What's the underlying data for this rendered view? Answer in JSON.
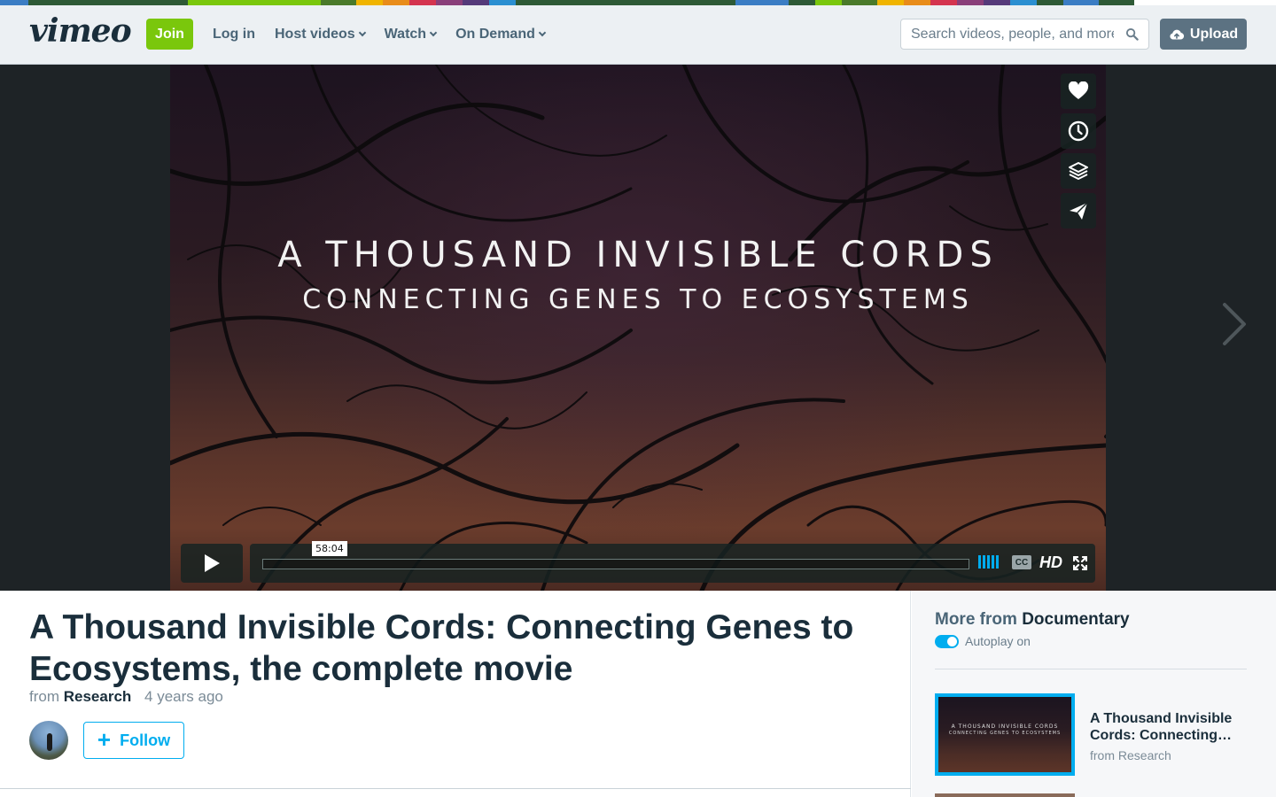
{
  "header": {
    "logo_text": "vimeo",
    "join_label": "Join",
    "nav": [
      {
        "label": "Log in",
        "has_dropdown": false
      },
      {
        "label": "Host videos",
        "has_dropdown": true
      },
      {
        "label": "Watch",
        "has_dropdown": true
      },
      {
        "label": "On Demand",
        "has_dropdown": true
      }
    ],
    "search_placeholder": "Search videos, people, and more",
    "upload_label": "Upload"
  },
  "colors": {
    "strip": [
      "#3b7dc4",
      "#2e5a36",
      "#7ac70c",
      "#4a7a2a",
      "#f0b400",
      "#e88c1a",
      "#d4344f",
      "#8a3f7a",
      "#553a7a",
      "#2b8fd1",
      "#2e5a36"
    ],
    "accent": "#00adef",
    "join_green": "#7ac70c",
    "heading": "#1a2e3b"
  },
  "player": {
    "overlay_title_line1": "A Thousand Invisible Cords",
    "overlay_title_line2": "Connecting Genes to Ecosystems",
    "duration_tooltip": "58:04",
    "side_actions": [
      "heart-icon",
      "clock-icon",
      "layers-icon",
      "send-icon"
    ],
    "cc_label": "CC",
    "hd_label": "HD"
  },
  "video": {
    "title": "A Thousand Invisible Cords: Connecting Genes to Ecosystems, the complete movie",
    "from_prefix": "from",
    "channel": "Research",
    "age": "4 years ago",
    "follow_label": "Follow"
  },
  "sidebar": {
    "more_prefix": "More from",
    "category": "Documentary",
    "autoplay_label": "Autoplay on",
    "items": [
      {
        "title": "A Thousand Invisible Cords: Connecting…",
        "from": "from Research",
        "thumb_line1": "A Thousand Invisible Cords",
        "thumb_line2": "Connecting Genes to Ecosystems"
      }
    ]
  }
}
